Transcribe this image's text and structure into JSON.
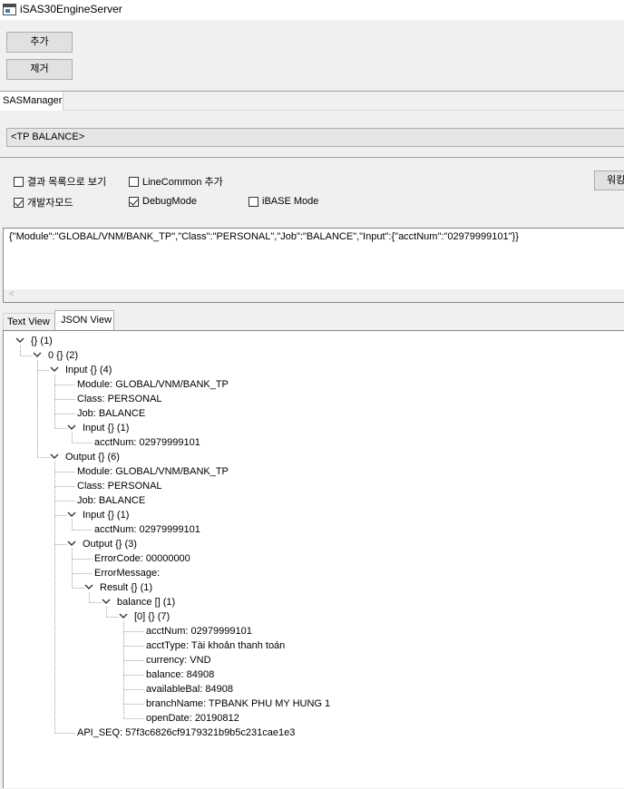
{
  "window": {
    "title": "iSAS30EngineServer"
  },
  "toolbar": {
    "add_label": "추가",
    "remove_label": "제거"
  },
  "tab": {
    "label": "SASManager"
  },
  "combo": {
    "value": "<TP BALANCE>"
  },
  "options": {
    "result_list": {
      "label": "결과 목록으로 보기",
      "checked": false
    },
    "linecommon": {
      "label": "LineCommon 추가",
      "checked": false
    },
    "dev_mode": {
      "label": "개발자모드",
      "checked": true
    },
    "debug_mode": {
      "label": "DebugMode",
      "checked": true
    },
    "ibase_mode": {
      "label": "iBASE Mode",
      "checked": false
    }
  },
  "side_button": {
    "label": "워킹"
  },
  "input": {
    "text": "{\"Module\":\"GLOBAL/VNM/BANK_TP\",\"Class\":\"PERSONAL\",\"Job\":\"BALANCE\",\"Input\":{\"acctNum\":\"02979999101\"}}"
  },
  "view_tabs": [
    "Text View",
    "JSON View"
  ],
  "tree": [
    {
      "text": "{} (1)",
      "level": 0,
      "expander": true
    },
    {
      "text": "0 {} (2)",
      "level": 1,
      "expander": true
    },
    {
      "text": "Input {} (4)",
      "level": 2,
      "expander": true
    },
    {
      "text": "Module: GLOBAL/VNM/BANK_TP",
      "level": 3,
      "expander": false
    },
    {
      "text": "Class: PERSONAL",
      "level": 3,
      "expander": false
    },
    {
      "text": "Job: BALANCE",
      "level": 3,
      "expander": false
    },
    {
      "text": "Input {} (1)",
      "level": 3,
      "expander": true
    },
    {
      "text": "acctNum: 02979999101",
      "level": 4,
      "expander": false
    },
    {
      "text": "Output {} (6)",
      "level": 2,
      "expander": true
    },
    {
      "text": "Module: GLOBAL/VNM/BANK_TP",
      "level": 3,
      "expander": false
    },
    {
      "text": "Class: PERSONAL",
      "level": 3,
      "expander": false
    },
    {
      "text": "Job: BALANCE",
      "level": 3,
      "expander": false
    },
    {
      "text": "Input {} (1)",
      "level": 3,
      "expander": true
    },
    {
      "text": "acctNum: 02979999101",
      "level": 4,
      "expander": false
    },
    {
      "text": "Output {} (3)",
      "level": 3,
      "expander": true
    },
    {
      "text": "ErrorCode: 00000000",
      "level": 4,
      "expander": false
    },
    {
      "text": "ErrorMessage:",
      "level": 4,
      "expander": false
    },
    {
      "text": "Result {} (1)",
      "level": 4,
      "expander": true
    },
    {
      "text": "balance [] (1)",
      "level": 5,
      "expander": true
    },
    {
      "text": "[0] {} (7)",
      "level": 6,
      "expander": true
    },
    {
      "text": "acctNum: 02979999101",
      "level": 7,
      "expander": false
    },
    {
      "text": "acctType: Tài khoản thanh toán",
      "level": 7,
      "expander": false
    },
    {
      "text": "currency: VND",
      "level": 7,
      "expander": false
    },
    {
      "text": "balance: 84908",
      "level": 7,
      "expander": false
    },
    {
      "text": "availableBal: 84908",
      "level": 7,
      "expander": false
    },
    {
      "text": "branchName: TPBANK PHU MY HUNG 1",
      "level": 7,
      "expander": false
    },
    {
      "text": "openDate: 20190812",
      "level": 7,
      "expander": false
    },
    {
      "text": "API_SEQ: 57f3c6826cf9179321b9b5c231cae1e3",
      "level": 3,
      "expander": false
    }
  ]
}
